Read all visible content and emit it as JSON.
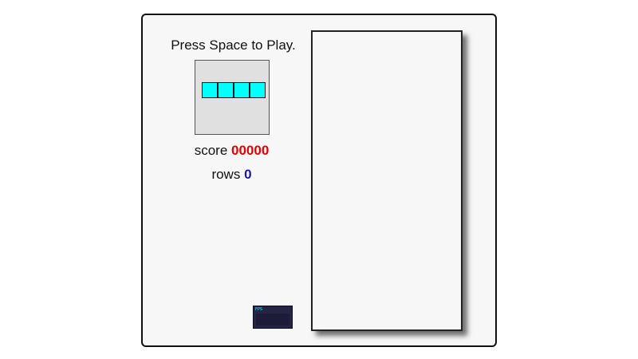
{
  "prompt": "Press Space to Play.",
  "next_piece": {
    "shape": "I",
    "color": "#00ffff",
    "blocks": 4
  },
  "score": {
    "label": "score",
    "value": "00000"
  },
  "rows": {
    "label": "rows",
    "value": "0"
  },
  "fps_meter": {
    "label": "FPS"
  },
  "colors": {
    "score_value": "#e00000",
    "rows_value": "#1a1aa0",
    "piece_i": "#00ffff"
  }
}
